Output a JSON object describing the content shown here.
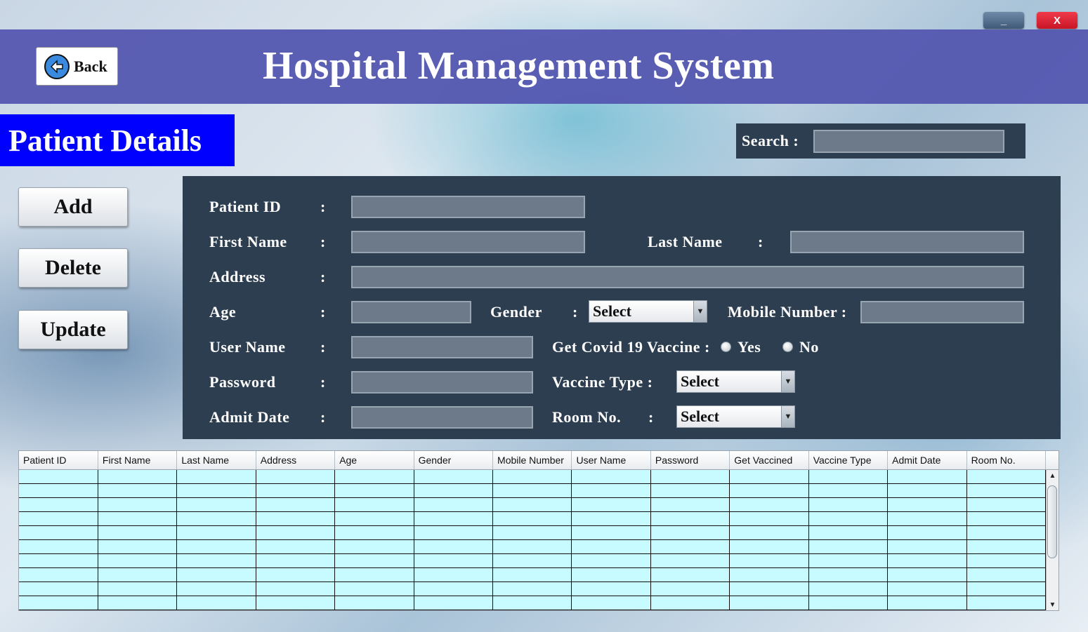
{
  "window": {
    "minimize_label": "_",
    "close_label": "X"
  },
  "header": {
    "back_label": "Back",
    "title": "Hospital Management System"
  },
  "section_title": "Patient Details",
  "search": {
    "label": "Search :",
    "value": ""
  },
  "actions": {
    "add": "Add",
    "delete": "Delete",
    "update": "Update"
  },
  "form": {
    "patient_id": {
      "label": "Patient ID",
      "value": ""
    },
    "first_name": {
      "label": "First Name",
      "value": ""
    },
    "last_name": {
      "label": "Last Name",
      "value": ""
    },
    "address": {
      "label": "Address",
      "value": ""
    },
    "age": {
      "label": "Age",
      "value": ""
    },
    "gender": {
      "label": "Gender",
      "selected": "Select"
    },
    "mobile": {
      "label": "Mobile Number :",
      "value": ""
    },
    "user_name": {
      "label": "User Name",
      "value": ""
    },
    "covid": {
      "label": "Get Covid 19 Vaccine :",
      "yes": "Yes",
      "no": "No"
    },
    "password": {
      "label": "Password",
      "value": ""
    },
    "vaccine_type": {
      "label": "Vaccine Type :",
      "selected": "Select"
    },
    "admit_date": {
      "label": "Admit Date",
      "value": ""
    },
    "room_no": {
      "label": "Room No.",
      "selected": "Select"
    },
    "colon": ":"
  },
  "table": {
    "columns": [
      "Patient ID",
      "First Name",
      "Last Name",
      "Address",
      "Age",
      "Gender",
      "Mobile Number",
      "User Name",
      "Password",
      "Get Vaccined",
      "Vaccine Type",
      "Admit Date",
      "Room No."
    ]
  }
}
